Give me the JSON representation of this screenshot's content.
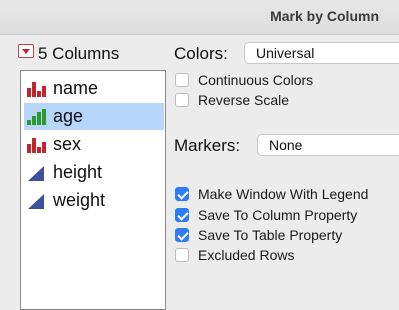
{
  "window": {
    "title": "Mark by Column"
  },
  "columns": {
    "header": "5 Columns",
    "items": [
      {
        "label": "name",
        "icon": "nominal-bar-icon",
        "selected": false
      },
      {
        "label": "age",
        "icon": "ordinal-bar-icon",
        "selected": true
      },
      {
        "label": "sex",
        "icon": "nominal-bar-icon",
        "selected": false
      },
      {
        "label": "height",
        "icon": "continuous-triangle-icon",
        "selected": false
      },
      {
        "label": "weight",
        "icon": "continuous-triangle-icon",
        "selected": false
      }
    ]
  },
  "colors": {
    "label": "Colors:",
    "value": "Universal"
  },
  "continuous_colors": {
    "label": "Continuous Colors",
    "checked": false
  },
  "reverse_scale": {
    "label": "Reverse Scale",
    "checked": false
  },
  "markers": {
    "label": "Markers:",
    "value": "None"
  },
  "options": [
    {
      "label": "Make Window With Legend",
      "checked": true
    },
    {
      "label": "Save To Column Property",
      "checked": true
    },
    {
      "label": "Save To Table Property",
      "checked": true
    },
    {
      "label": "Excluded Rows",
      "checked": false
    }
  ],
  "palette": {
    "accent": "#2f7cf6",
    "selection": "#b6d6fb",
    "nominal": "#c0262b",
    "ordinal": "#2e9a2e",
    "continuous": "#3f4f9a"
  }
}
